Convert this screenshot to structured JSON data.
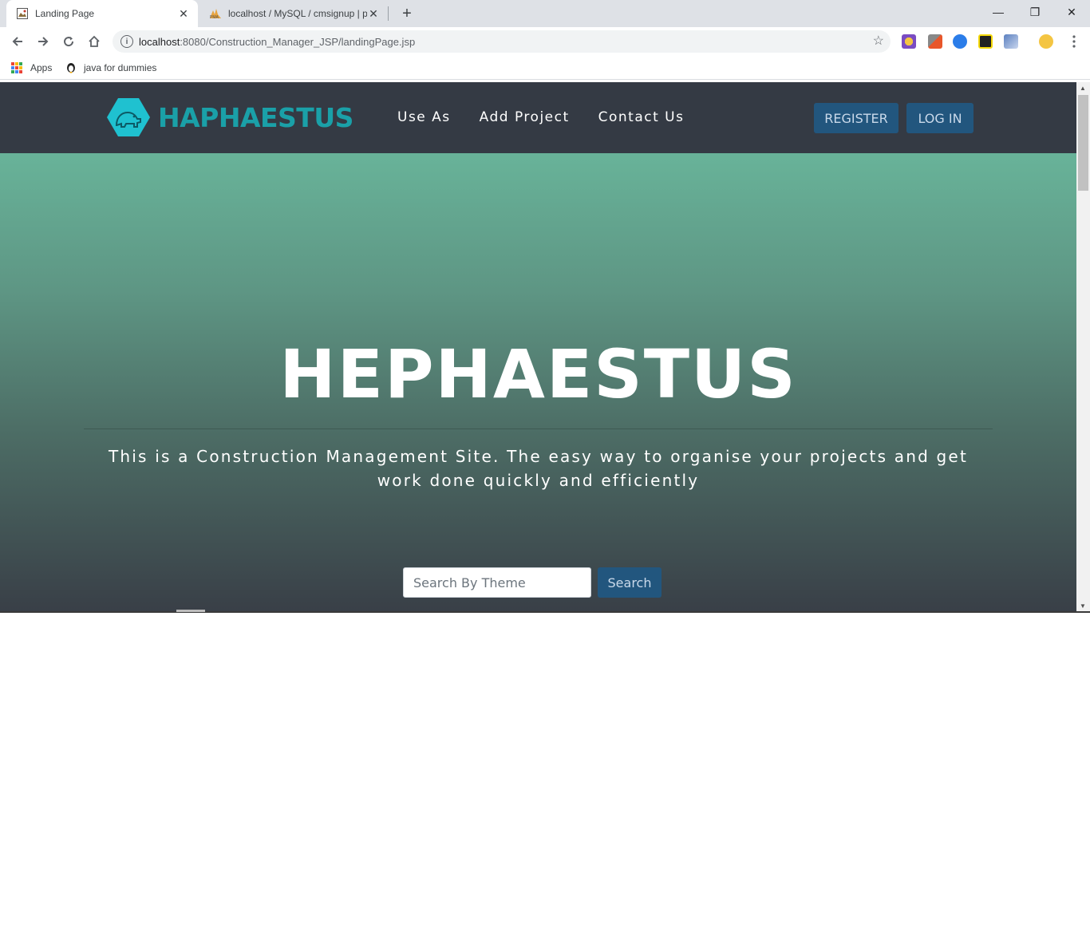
{
  "browser": {
    "tabs": [
      {
        "title": "Landing Page",
        "active": true
      },
      {
        "title": "localhost / MySQL / cmsignup | p",
        "active": false
      }
    ],
    "url_host": "localhost",
    "url_path": ":8080/Construction_Manager_JSP/landingPage.jsp",
    "bookmarks": [
      {
        "label": "Apps"
      },
      {
        "label": "java for dummies"
      }
    ]
  },
  "navbar": {
    "brand": "HAPHAESTUS",
    "links": [
      "Use As",
      "Add Project",
      "Contact Us"
    ],
    "register_label": "REGISTER",
    "login_label": "LOG IN"
  },
  "hero": {
    "heading": "HEPHAESTUS",
    "tagline": "This is a Construction Management Site. The easy way to organise your projects and get work done quickly and efficiently",
    "search_placeholder": "Search By Theme",
    "search_button": "Search"
  },
  "colors": {
    "navbar_bg": "#343a44",
    "brand_teal": "#1aa0a8",
    "button_blue": "#22567e",
    "hero_top": "#68b399",
    "hero_bottom": "#393f47"
  }
}
